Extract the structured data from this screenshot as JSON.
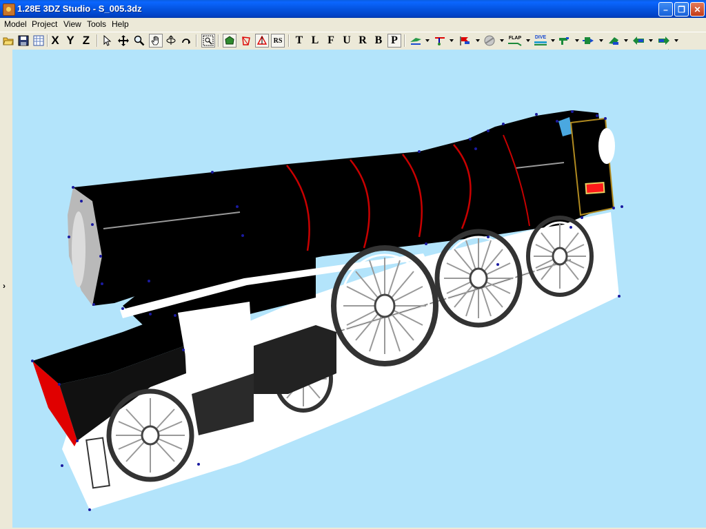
{
  "window": {
    "title": "1.28E 3DZ Studio - S_005.3dz",
    "minimize": "–",
    "maximize": "❐",
    "close": "✕"
  },
  "menu": {
    "model": "Model",
    "project": "Project",
    "view": "View",
    "tools": "Tools",
    "help": "Help"
  },
  "toolbar": {
    "axis_x": "X",
    "axis_y": "Y",
    "axis_z": "Z",
    "rs": "RS",
    "view_t": "T",
    "view_l": "L",
    "view_f": "F",
    "view_u": "U",
    "view_r": "R",
    "view_b": "B",
    "view_p": "P",
    "flap": "FLAP",
    "dive": "DIVE"
  },
  "sidebar": {
    "expand": "›"
  },
  "colors": {
    "viewport_bg": "#b3e4fb",
    "titlebar": "#0454e0",
    "model_red": "#e00000",
    "model_black": "#000000",
    "vertex": "#1a1aa0"
  }
}
